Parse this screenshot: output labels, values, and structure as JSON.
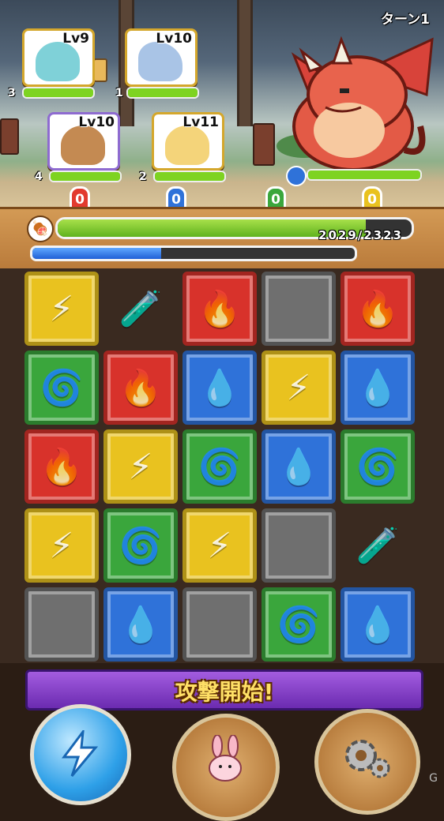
{
  "battle": {
    "turn_label": "ターン1",
    "party": [
      {
        "level_label": "Lv9",
        "count": "3",
        "hp_fraction": 1.0
      },
      {
        "level_label": "Lv10",
        "count": "1",
        "hp_fraction": 1.0
      },
      {
        "level_label": "Lv10",
        "count": "4",
        "hp_fraction": 1.0
      },
      {
        "level_label": "Lv11",
        "count": "2",
        "hp_fraction": 1.0
      }
    ],
    "combo_counters": [
      {
        "value": "0",
        "color": "#e23a2e"
      },
      {
        "value": "0",
        "color": "#2f72d9"
      },
      {
        "value": "0",
        "color": "#3aa63c"
      },
      {
        "value": "0",
        "color": "#e9c21f"
      }
    ],
    "enemy_hp_fraction": 1.0
  },
  "status": {
    "hp_text": "2029/2323",
    "hp_fraction": 0.87,
    "skill_fraction": 0.4
  },
  "board": {
    "rows": [
      [
        "light",
        "potion",
        "fire",
        "stone",
        "fire"
      ],
      [
        "wood",
        "fire",
        "water",
        "light",
        "water"
      ],
      [
        "fire",
        "light",
        "wood",
        "water",
        "wood"
      ],
      [
        "light",
        "wood",
        "light",
        "stone",
        "potion"
      ],
      [
        "stone",
        "water",
        "stone",
        "wood",
        "water"
      ]
    ],
    "glyphs": {
      "fire": "🔥",
      "water": "💧",
      "wood": "🌀",
      "light": "⚡",
      "stone": "",
      "potion": "🧪"
    }
  },
  "controls": {
    "attack_label": "攻撃開始!",
    "skill_icon": "lightning-icon",
    "pet_icon": "bunny-icon",
    "settings_icon": "gear-icon"
  }
}
